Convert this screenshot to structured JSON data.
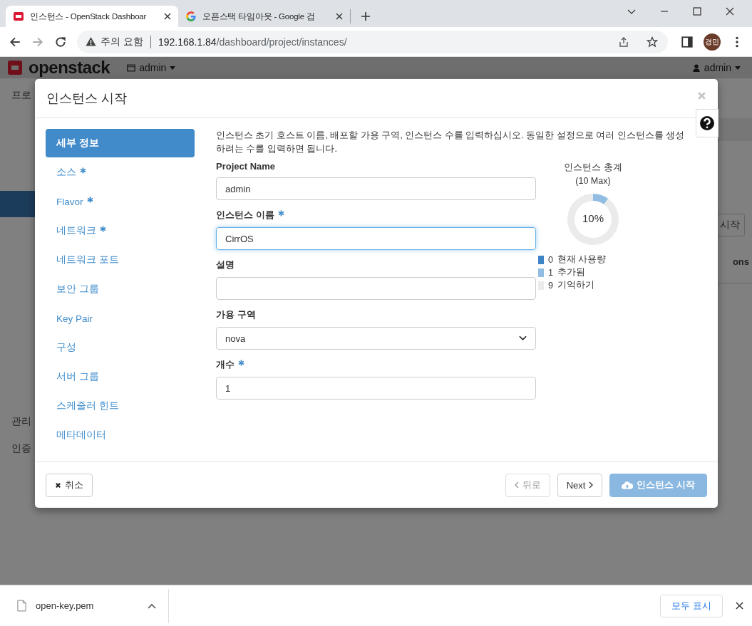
{
  "browser": {
    "tabs": [
      {
        "title": "인스턴스 - OpenStack Dashboar",
        "selected": true
      },
      {
        "title": "오픈스택 타임아웃 - Google 검",
        "selected": false
      }
    ],
    "address": {
      "warning": "주의 요함",
      "url_host": "192.168.1.84",
      "url_path": "/dashboard/project/instances/"
    },
    "profile": "경민"
  },
  "dashboard": {
    "logo": "openstack",
    "project": "admin",
    "user": "admin",
    "background_texts": {
      "sidebar_top": "프로",
      "sidebar_admin": "관리",
      "sidebar_identity": "인증",
      "right_button": "시작",
      "right_column": "ons"
    }
  },
  "modal": {
    "title": "인스턴스 시작",
    "steps": [
      {
        "label": "세부 정보",
        "required": false,
        "selected": true
      },
      {
        "label": "소스",
        "required": true,
        "selected": false
      },
      {
        "label": "Flavor",
        "required": true,
        "selected": false
      },
      {
        "label": "네트워크",
        "required": true,
        "selected": false
      },
      {
        "label": "네트워크 포트",
        "required": false,
        "selected": false
      },
      {
        "label": "보안 그룹",
        "required": false,
        "selected": false
      },
      {
        "label": "Key Pair",
        "required": false,
        "selected": false
      },
      {
        "label": "구성",
        "required": false,
        "selected": false
      },
      {
        "label": "서버 그룹",
        "required": false,
        "selected": false
      },
      {
        "label": "스케줄러 힌트",
        "required": false,
        "selected": false
      },
      {
        "label": "메타데이터",
        "required": false,
        "selected": false
      }
    ],
    "description": "인스턴스 초기 호스트 이름, 배포할 가용 구역, 인스턴스 수를 입력하십시오. 동일한 설정으로 여러 인스턴스를 생성하려는 수를 입력하면 됩니다.",
    "fields": [
      {
        "kind": "text",
        "label": "Project Name",
        "required": false,
        "value": "admin",
        "focused": false
      },
      {
        "kind": "text",
        "label": "인스턴스 이름",
        "required": true,
        "value": "CirrOS",
        "focused": true
      },
      {
        "kind": "text",
        "label": "설명",
        "required": false,
        "focused": false
      },
      {
        "kind": "select",
        "label": "가용 구역",
        "required": false,
        "value": "nova",
        "focused": false
      },
      {
        "kind": "text",
        "label": "개수",
        "required": true,
        "value": "1",
        "focused": false
      }
    ],
    "quota": {
      "title": "인스턴스 총계",
      "subtitle": "(10 Max)",
      "center_label": "10%",
      "chart_data": {
        "type": "donut",
        "values": [
          0,
          10,
          90
        ],
        "colors": [
          "#3d84c6",
          "#92bde3",
          "#ebebeb"
        ]
      },
      "legend": [
        {
          "count": "0",
          "label": "현재 사용량",
          "color": "#3d84c6"
        },
        {
          "count": "1",
          "label": "추가됨",
          "color": "#92bde3"
        },
        {
          "count": "9",
          "label": "기억하기",
          "color": "#ebebeb"
        }
      ]
    },
    "buttons": [
      {
        "kind": "cancel",
        "label": "취소",
        "disabled": false
      },
      {
        "kind": "back",
        "label": "뒤로",
        "disabled": true
      },
      {
        "kind": "next",
        "label": "Next",
        "disabled": false
      },
      {
        "kind": "launch",
        "label": "인스턴스 시작",
        "disabled": true
      }
    ]
  },
  "downloads": {
    "file": "open-key.pem",
    "show_all": "모두 표시"
  }
}
